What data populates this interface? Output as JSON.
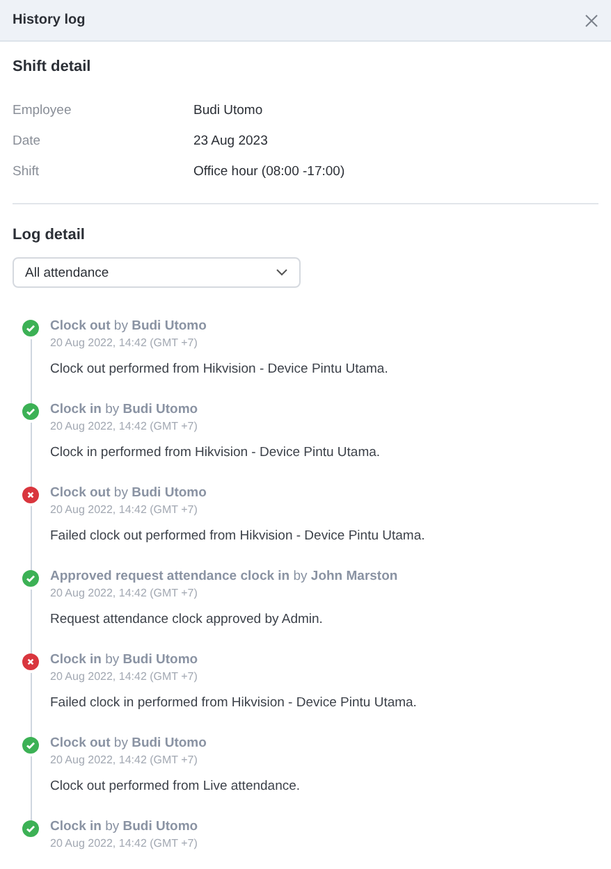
{
  "window": {
    "title": "History log"
  },
  "shift_detail": {
    "heading": "Shift detail",
    "fields": [
      {
        "label": "Employee",
        "value": "Budi Utomo"
      },
      {
        "label": "Date",
        "value": "23 Aug 2023"
      },
      {
        "label": "Shift",
        "value": "Office hour (08:00 -17:00)"
      }
    ]
  },
  "log_detail": {
    "heading": "Log detail",
    "filter": {
      "value": "All attendance"
    },
    "entries": [
      {
        "kind": "success",
        "title": "**Clock out** by **Budi Utomo**",
        "time": "20 Aug 2022, 14:42 (GMT +7)",
        "message": "Clock out performed from Hikvision - Device Pintu Utama."
      },
      {
        "kind": "success",
        "title": "**Clock in** by **Budi Utomo**",
        "time": "20 Aug 2022, 14:42 (GMT +7)",
        "message": "Clock in performed from Hikvision - Device Pintu Utama."
      },
      {
        "kind": "failed",
        "title": "**Clock out** by **Budi Utomo**",
        "time": "20 Aug 2022, 14:42 (GMT +7)",
        "message": "Failed clock out performed from Hikvision - Device Pintu Utama."
      },
      {
        "kind": "success",
        "title": "**Approved request attendance clock in** by **John Marston**",
        "time": "20 Aug 2022, 14:42 (GMT +7)",
        "message": "Request attendance clock approved by Admin."
      },
      {
        "kind": "failed",
        "title": "**Clock in** by **Budi Utomo**",
        "time": "20 Aug 2022, 14:42 (GMT +7)",
        "message": "Failed clock in performed from Hikvision - Device Pintu Utama."
      },
      {
        "kind": "success",
        "title": "**Clock out** by **Budi Utomo**",
        "time": "20 Aug 2022, 14:42 (GMT +7)",
        "message": "Clock out performed from Live attendance."
      },
      {
        "kind": "success",
        "title": "**Clock in** by **Budi Utomo**",
        "time": "20 Aug 2022, 14:42 (GMT +7)"
      }
    ]
  }
}
